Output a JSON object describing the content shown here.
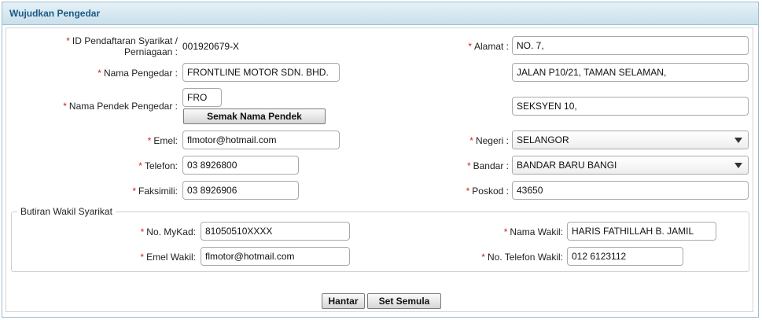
{
  "panel": {
    "title": "Wujudkan Pengedar"
  },
  "form": {
    "id_label_1": "ID Pendaftaran Syarikat /",
    "id_label_2": "Perniagaan :",
    "id_value": "001920679-X",
    "nama_label": "Nama Pengedar :",
    "nama_value": "FRONTLINE MOTOR SDN. BHD.",
    "pendek_label": "Nama Pendek Pengedar :",
    "pendek_value": "FRO",
    "semak_button": "Semak Nama Pendek",
    "emel_label": "Emel:",
    "emel_value": "flmotor@hotmail.com",
    "telefon_label": "Telefon:",
    "telefon_value": "03 8926800",
    "faks_label": "Faksimili:",
    "faks_value": "03 8926906",
    "alamat_label": "Alamat :",
    "alamat_1": "NO. 7,",
    "alamat_2": "JALAN P10/21, TAMAN SELAMAN,",
    "alamat_3": "SEKSYEN 10,",
    "negeri_label": "Negeri :",
    "negeri_value": "SELANGOR",
    "bandar_label": "Bandar :",
    "bandar_value": "BANDAR BARU BANGI",
    "poskod_label": "Poskod :",
    "poskod_value": "43650"
  },
  "wakil": {
    "legend": "Butiran Wakil Syarikat",
    "mykad_label": "No. MyKad:",
    "mykad_value": "81050510XXXX",
    "emel_label": "Emel Wakil:",
    "emel_value": "flmotor@hotmail.com",
    "nama_label": "Nama Wakil:",
    "nama_value": "HARIS FATHILLAH B. JAMIL",
    "tel_label": "No. Telefon Wakil:",
    "tel_value": "012 6123112"
  },
  "actions": {
    "submit": "Hantar",
    "reset": "Set Semula"
  },
  "required_mark": "*"
}
